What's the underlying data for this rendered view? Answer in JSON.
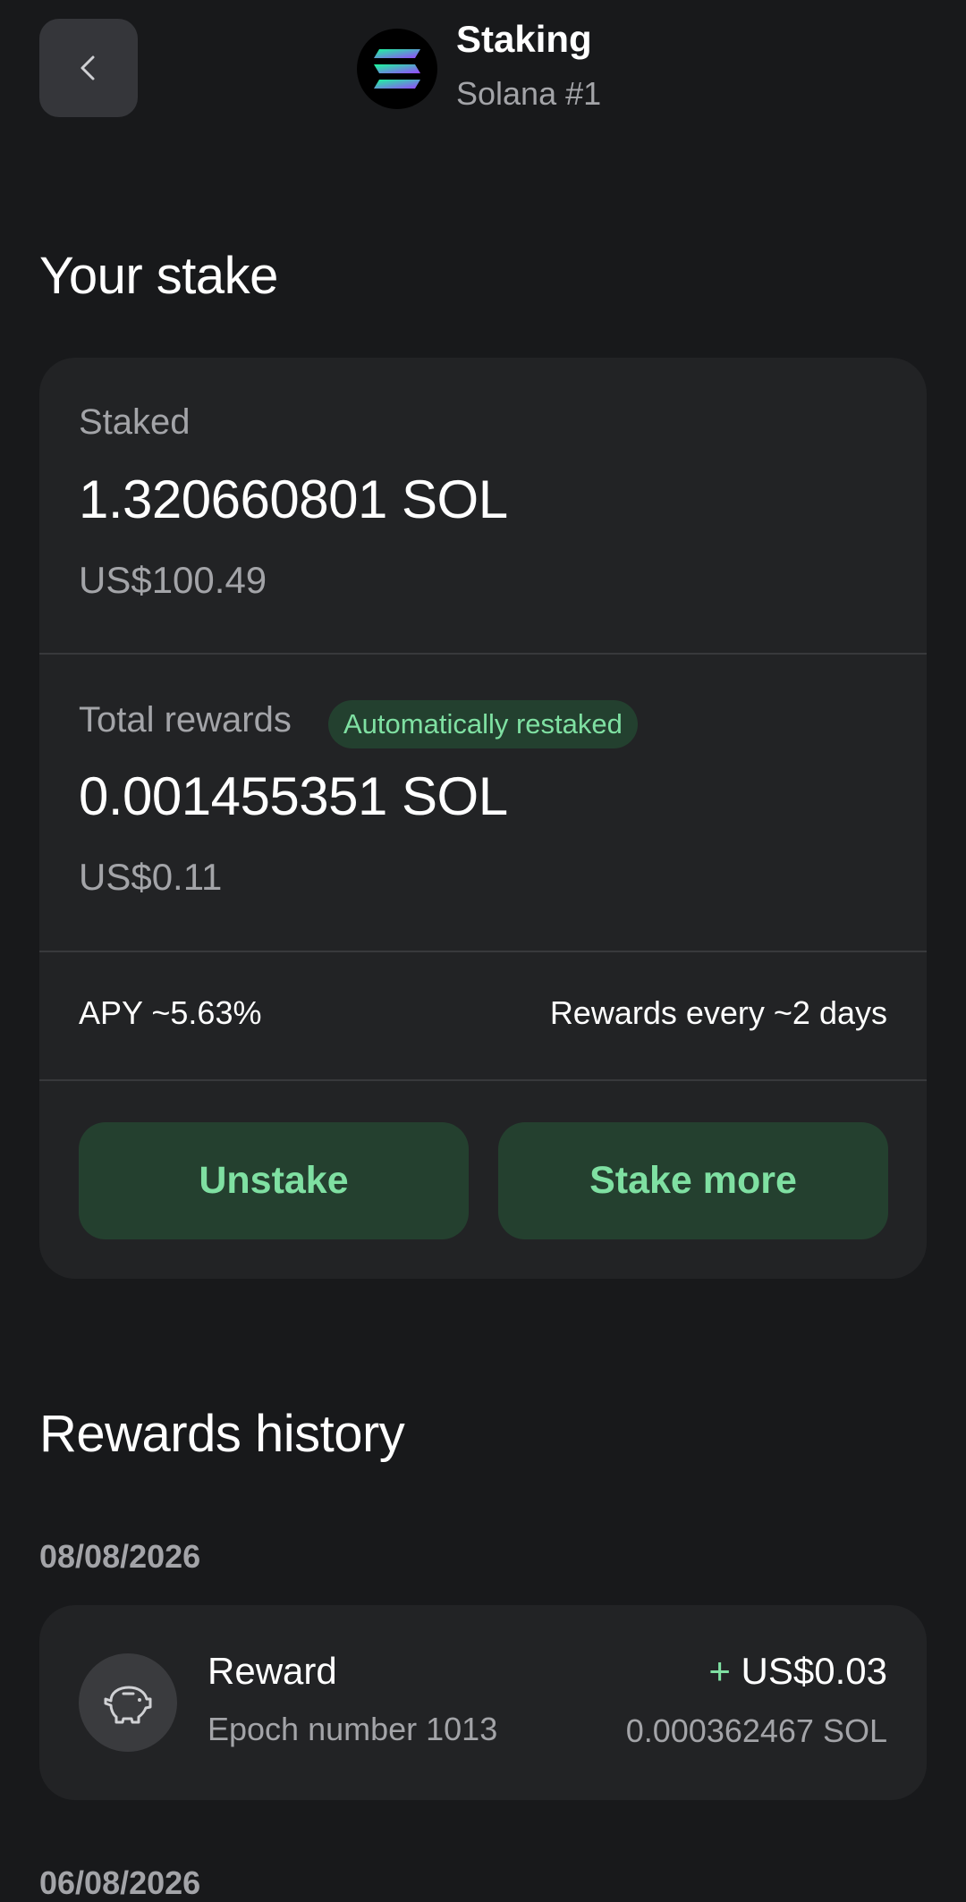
{
  "header": {
    "title": "Staking",
    "subtitle": "Solana #1",
    "back_icon": "chevron-left-icon",
    "token_icon": "solana-logo"
  },
  "your_stake": {
    "title": "Your stake",
    "staked": {
      "label": "Staked",
      "amount": "1.320660801 SOL",
      "fiat": "US$100.49"
    },
    "rewards": {
      "label": "Total rewards",
      "badge": "Automatically restaked",
      "amount": "0.001455351 SOL",
      "fiat": "US$0.11"
    },
    "apy": "APY ~5.63%",
    "frequency": "Rewards every ~2 days",
    "buttons": {
      "unstake": "Unstake",
      "stake_more": "Stake more"
    }
  },
  "rewards_history": {
    "title": "Rewards history",
    "groups": [
      {
        "date": "08/08/2026",
        "items": [
          {
            "title": "Reward",
            "subtitle": "Epoch number 1013",
            "sign": "+",
            "fiat": "US$0.03",
            "sol": "0.000362467 SOL",
            "icon": "piggy-bank-icon"
          }
        ]
      },
      {
        "date": "06/08/2026",
        "items": []
      }
    ]
  },
  "colors": {
    "background": "#18191b",
    "card": "#222325",
    "accent_green": "#7fe0a2",
    "button_bg": "#24402f",
    "muted_text": "#a3a4a8"
  }
}
